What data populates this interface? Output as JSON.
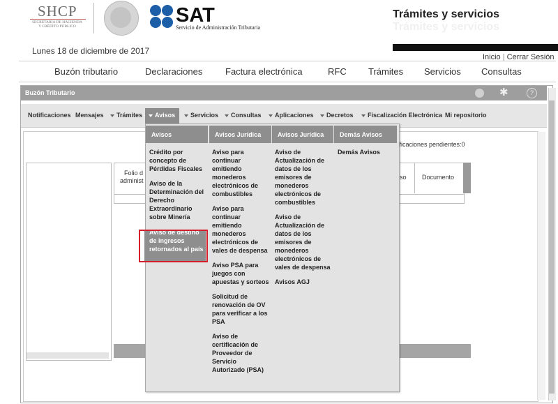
{
  "header": {
    "shcp_title": "SHCP",
    "shcp_sub1": "SECRETARÍA DE HACIENDA",
    "shcp_sub2": "Y CRÉDITO PÚBLICO",
    "sat_word": "SAT",
    "sat_sub": "Servicio de Administración Tributaria",
    "tramites_title": "Trámites y servicios",
    "tramites_shadow": "Trámites y servicios",
    "date": "Lunes 18 de diciembre de 2017",
    "link_inicio": "Inicio",
    "link_cerrar": "Cerrar Sesión",
    "colors": {
      "brand_blue": "#1d5ea8",
      "shcp_red": "#b94d4d"
    }
  },
  "main_nav": [
    "Buzón tributario",
    "Declaraciones",
    "Factura electrónica",
    "RFC",
    "Trámites",
    "Servicios",
    "Consultas"
  ],
  "app": {
    "title": "Buzón Tributario",
    "icons": [
      "circle-icon",
      "gear-icon",
      "help-icon"
    ],
    "subnav": {
      "notificaciones": "Notificaciones",
      "mensajes": "Mensajes",
      "tramites": "Trámites",
      "avisos": "Avisos",
      "servicios": "Servicios",
      "consultas": "Consultas",
      "aplicaciones": "Aplicaciones",
      "decretos": "Decretos",
      "fiscalizacion": "Fiscalización Electrónica",
      "repositorio": "Mi repositorio"
    },
    "pending": "tificaciones pendientes:0",
    "table": {
      "folio1": "Folio d",
      "folio2": "administ",
      "aviso": "iso",
      "documento": "Documento"
    }
  },
  "dropdown": {
    "headers": [
      "Avisos",
      "Avisos Jurídica",
      "Avisos Jurídica",
      "Demás Avisos"
    ],
    "col1": [
      "Crédito por concepto de Pérdidas Fiscales",
      "Aviso de la Determinación del Derecho Extraordinario sobre Minería",
      "Aviso de destino de ingresos retornados al país"
    ],
    "col2": [
      "Aviso para continuar emitiendo monederos electrónicos de combustibles",
      "Aviso para continuar emitiendo monederos electrónicos de vales de despensa",
      "Aviso PSA para juegos con apuestas y sorteos",
      "Solicitud de renovación de OV para verificar a los PSA",
      "Aviso de certificación de Proveedor de Servicio Autorizado (PSA)"
    ],
    "col3": [
      "Aviso de Actualización de datos de los emisores de monederos electrónicos de combustibles",
      "Aviso de Actualización de datos de los emisores de monederos electrónicos de vales de despensa",
      "Avisos AGJ"
    ],
    "col4": [
      "Demás Avisos"
    ],
    "highlight_color": "#d21f2a"
  }
}
